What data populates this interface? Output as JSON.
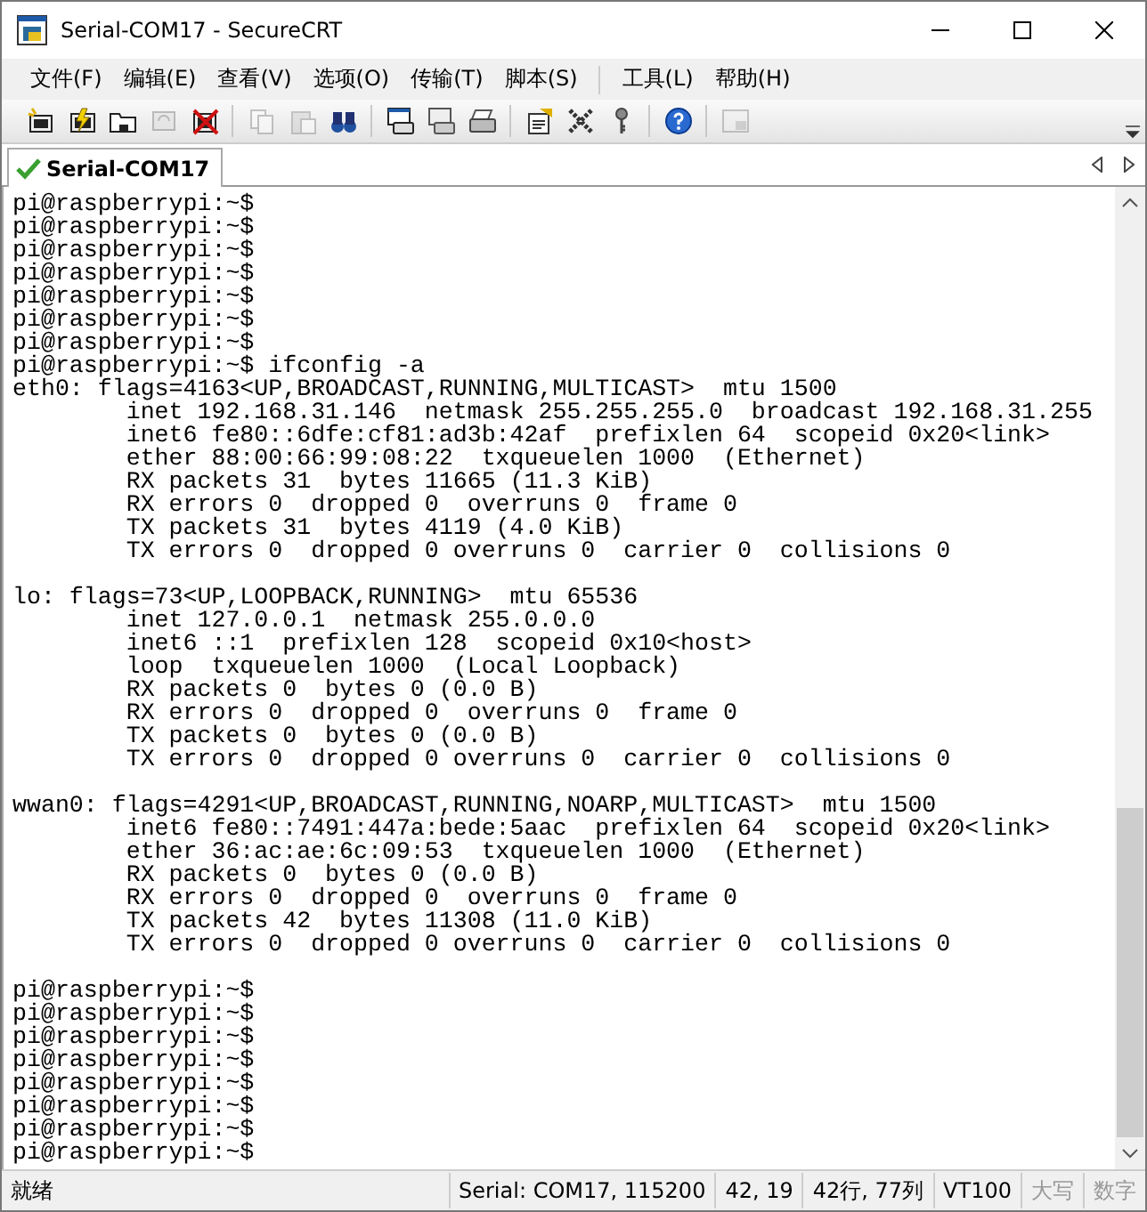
{
  "window": {
    "title": "Serial-COM17 - SecureCRT"
  },
  "menu": [
    [
      {
        "label": "文件(F)"
      },
      {
        "label": "编辑(E)"
      },
      {
        "label": "查看(V)"
      },
      {
        "label": "选项(O)"
      },
      {
        "label": "传输(T)"
      },
      {
        "label": "脚本(S)"
      }
    ],
    [
      {
        "label": "工具(L)"
      },
      {
        "label": "帮助(H)"
      }
    ]
  ],
  "toolbar": [
    [
      {
        "kind": "connect",
        "disabled": false
      },
      {
        "kind": "quick",
        "disabled": false
      },
      {
        "kind": "folder",
        "disabled": false
      },
      {
        "kind": "reconnect",
        "disabled": true
      },
      {
        "kind": "disconnect",
        "disabled": false
      }
    ],
    [
      {
        "kind": "copy",
        "disabled": true
      },
      {
        "kind": "paste",
        "disabled": true
      },
      {
        "kind": "find",
        "disabled": false
      }
    ],
    [
      {
        "kind": "print",
        "disabled": false
      },
      {
        "kind": "printsel",
        "disabled": false
      },
      {
        "kind": "printer",
        "disabled": false
      }
    ],
    [
      {
        "kind": "options",
        "disabled": false
      },
      {
        "kind": "gear",
        "disabled": false
      },
      {
        "kind": "key",
        "disabled": false
      }
    ],
    [
      {
        "kind": "help",
        "disabled": false
      }
    ],
    [
      {
        "kind": "window",
        "disabled": true
      }
    ]
  ],
  "tabs": [
    {
      "label": "Serial-COM17",
      "selected": true
    }
  ],
  "terminal": {
    "blocks": [
      [
        "pi@raspberrypi:~$",
        "pi@raspberrypi:~$",
        "pi@raspberrypi:~$",
        "pi@raspberrypi:~$",
        "pi@raspberrypi:~$",
        "pi@raspberrypi:~$",
        "pi@raspberrypi:~$",
        "pi@raspberrypi:~$ ifconfig -a",
        "eth0: flags=4163<UP,BROADCAST,RUNNING,MULTICAST>  mtu 1500",
        "        inet 192.168.31.146  netmask 255.255.255.0  broadcast 192.168.31.255",
        "        inet6 fe80::6dfe:cf81:ad3b:42af  prefixlen 64  scopeid 0x20<link>",
        "        ether 88:00:66:99:08:22  txqueuelen 1000  (Ethernet)",
        "        RX packets 31  bytes 11665 (11.3 KiB)",
        "        RX errors 0  dropped 0  overruns 0  frame 0",
        "        TX packets 31  bytes 4119 (4.0 KiB)",
        "        TX errors 0  dropped 0 overruns 0  carrier 0  collisions 0"
      ],
      [
        "lo: flags=73<UP,LOOPBACK,RUNNING>  mtu 65536",
        "        inet 127.0.0.1  netmask 255.0.0.0",
        "        inet6 ::1  prefixlen 128  scopeid 0x10<host>",
        "        loop  txqueuelen 1000  (Local Loopback)",
        "        RX packets 0  bytes 0 (0.0 B)",
        "        RX errors 0  dropped 0  overruns 0  frame 0",
        "        TX packets 0  bytes 0 (0.0 B)",
        "        TX errors 0  dropped 0 overruns 0  carrier 0  collisions 0"
      ],
      [
        "wwan0: flags=4291<UP,BROADCAST,RUNNING,NOARP,MULTICAST>  mtu 1500",
        "        inet6 fe80::7491:447a:bede:5aac  prefixlen 64  scopeid 0x20<link>",
        "        ether 36:ac:ae:6c:09:53  txqueuelen 1000  (Ethernet)",
        "        RX packets 0  bytes 0 (0.0 B)",
        "        RX errors 0  dropped 0  overruns 0  frame 0",
        "        TX packets 42  bytes 11308 (11.0 KiB)",
        "        TX errors 0  dropped 0 overruns 0  carrier 0  collisions 0"
      ],
      [
        "pi@raspberrypi:~$",
        "pi@raspberrypi:~$",
        "pi@raspberrypi:~$",
        "pi@raspberrypi:~$",
        "pi@raspberrypi:~$",
        "pi@raspberrypi:~$",
        "pi@raspberrypi:~$",
        "pi@raspberrypi:~$"
      ]
    ]
  },
  "status_bar": {
    "message": "就绪",
    "panes": [
      {
        "text": "Serial: COM17, 115200",
        "on": true
      },
      {
        "text": "42,  19",
        "on": true
      },
      {
        "text": "42行, 77列",
        "on": true
      },
      {
        "text": "VT100",
        "on": true
      },
      {
        "text": "大写",
        "on": false
      },
      {
        "text": "数字",
        "on": false
      }
    ]
  }
}
